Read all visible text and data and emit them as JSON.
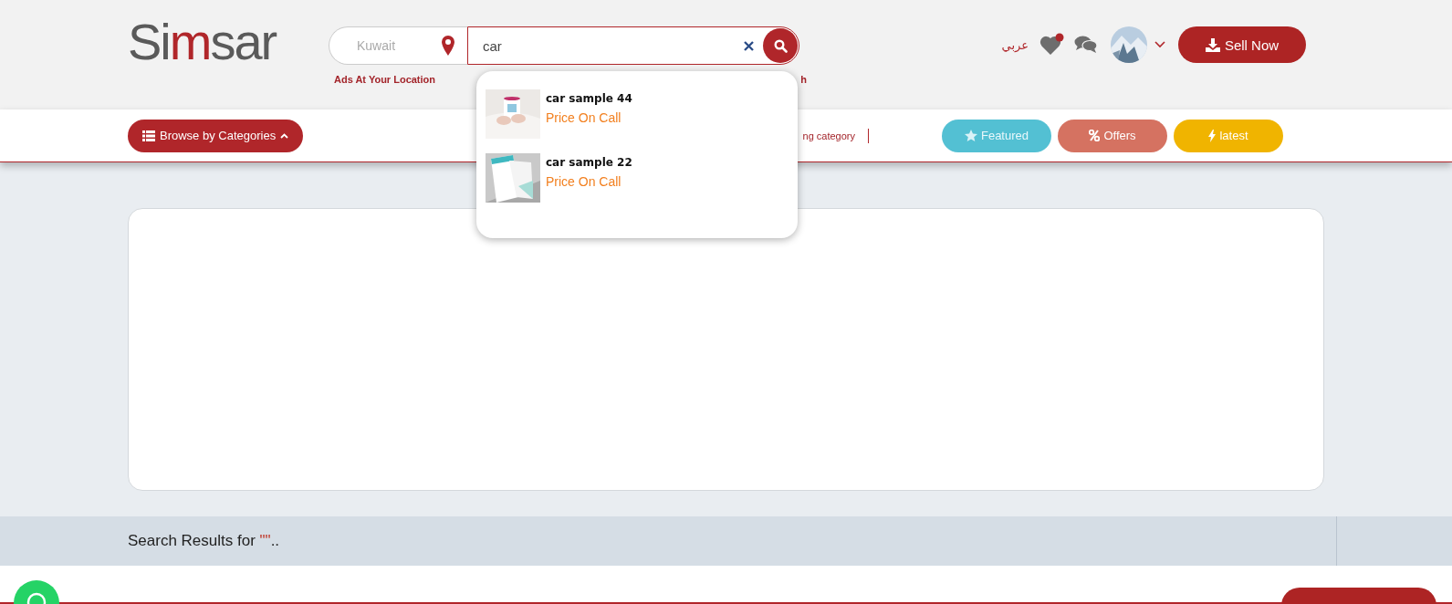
{
  "header": {
    "logo": {
      "part1": "Si",
      "part2": "m",
      "part3": "sar"
    },
    "location": {
      "value": "Kuwait",
      "caption": "Ads At Your Location"
    },
    "search": {
      "value": "car",
      "hint_fragment": "h"
    },
    "language": "عربي",
    "favorites_badge": true,
    "sell_button": "Sell Now"
  },
  "suggestions": [
    {
      "title": "car sample 44",
      "price": "Price On Call",
      "kind": "picture"
    },
    {
      "title": "car sample 22",
      "price": "Price On Call",
      "kind": "picture"
    }
  ],
  "nav": {
    "browse": "Browse by Categories",
    "category_fragment": "ng category",
    "filters": [
      {
        "label": "Featured",
        "kind": "star",
        "color": "#53c0d3"
      },
      {
        "label": "Offers",
        "kind": "percent",
        "color": "#d57261"
      },
      {
        "label": "latest",
        "kind": "bolt",
        "color": "#f0b400"
      }
    ]
  },
  "results": {
    "prefix": "Search Results for ",
    "query": "\"\"",
    "suffix": ".."
  }
}
